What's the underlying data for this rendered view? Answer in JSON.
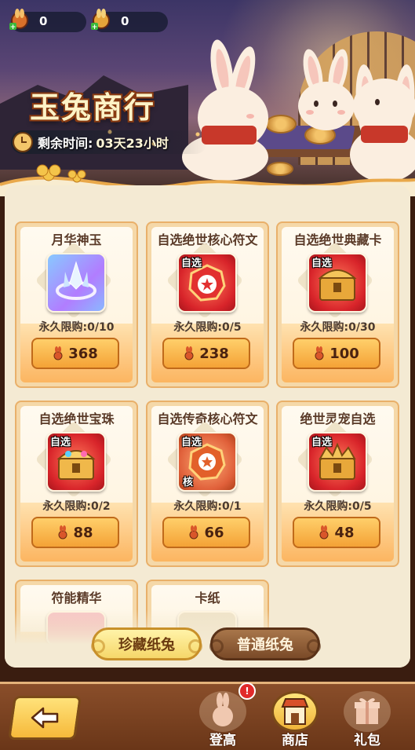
{
  "currencies": [
    {
      "icon": "rabbit-token-icon",
      "value": "0"
    },
    {
      "icon": "rabbit-token-gold-icon",
      "value": "0"
    }
  ],
  "banner": {
    "title": "玉兔商行",
    "timer_label": "剩余时间:",
    "timer_value": "03天23小时"
  },
  "items": [
    {
      "name": "月华神玉",
      "tag": "",
      "icon": "crystal-crown-icon",
      "limit": "永久限购:0/10",
      "price": "368"
    },
    {
      "name": "自选绝世核心符文",
      "tag": "自选",
      "icon": "red-rune-icon",
      "limit": "永久限购:0/5",
      "price": "238"
    },
    {
      "name": "自选绝世典藏卡",
      "tag": "自选",
      "icon": "gold-chest-icon",
      "limit": "永久限购:0/30",
      "price": "100"
    },
    {
      "name": "自选绝世宝珠",
      "tag": "自选",
      "icon": "jewel-chest-icon",
      "limit": "永久限购:0/2",
      "price": "88"
    },
    {
      "name": "自选传奇核心符文",
      "tag": "自选",
      "icon": "orange-rune-icon",
      "limit": "永久限购:0/1",
      "price": "66",
      "sub_tag": "核"
    },
    {
      "name": "绝世灵宠自选",
      "tag": "自选",
      "icon": "pet-chest-icon",
      "limit": "永久限购:0/5",
      "price": "48"
    },
    {
      "name": "符能精华",
      "tag": "",
      "icon": "essence-icon",
      "limit": "",
      "price": ""
    },
    {
      "name": "卡纸",
      "tag": "",
      "icon": "card-paper-icon",
      "limit": "",
      "price": ""
    }
  ],
  "tabs": [
    {
      "label": "珍藏纸兔",
      "active": true
    },
    {
      "label": "普通纸兔",
      "active": false
    }
  ],
  "nav": [
    {
      "label": "登高",
      "icon": "rabbit-silhouette-icon",
      "badge": "!"
    },
    {
      "label": "商店",
      "icon": "shop-icon",
      "active": true
    },
    {
      "label": "礼包",
      "icon": "gift-box-icon"
    }
  ],
  "colors": {
    "accent": "#f4a236",
    "panel": "#f4ead3",
    "bottom_bar": "#7a3e1e"
  }
}
